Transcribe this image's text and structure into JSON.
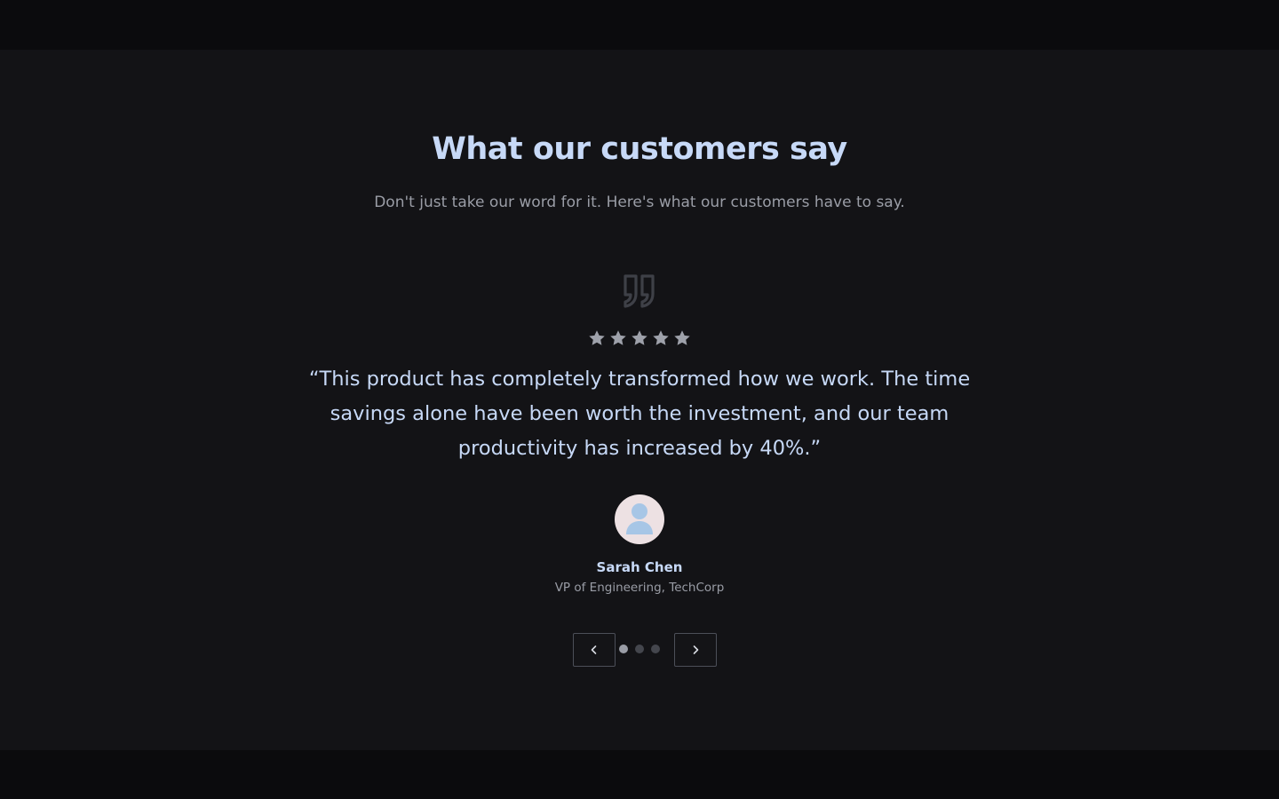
{
  "section": {
    "title": "What our customers say",
    "subtitle": "Don't just take our word for it. Here's what our customers have to say."
  },
  "testimonial": {
    "rating": 5,
    "rating_max": 5,
    "quote": "“This product has completely transformed how we work. The time savings alone have been worth the investment, and our team productivity has increased by 40%.”",
    "author_name": "Sarah Chen",
    "author_role": "VP of Engineering, TechCorp"
  },
  "carousel": {
    "total_slides": 3,
    "active_slide": 1
  },
  "icons": {
    "quote": "quote-icon",
    "star": "star-icon",
    "avatar": "user-avatar-icon",
    "prev": "chevron-left-icon",
    "next": "chevron-right-icon"
  },
  "colors": {
    "background": "#131316",
    "page_band": "#0b0b0d",
    "heading": "#c7d9f7",
    "muted": "#9a9da6",
    "star": "#9ea1aa",
    "quote_icon": "#3e4047",
    "avatar_bg": "#ede1e3",
    "avatar_figure": "#a7c6e6",
    "dot_active": "#9a9da6",
    "dot_inactive": "#44464d"
  }
}
